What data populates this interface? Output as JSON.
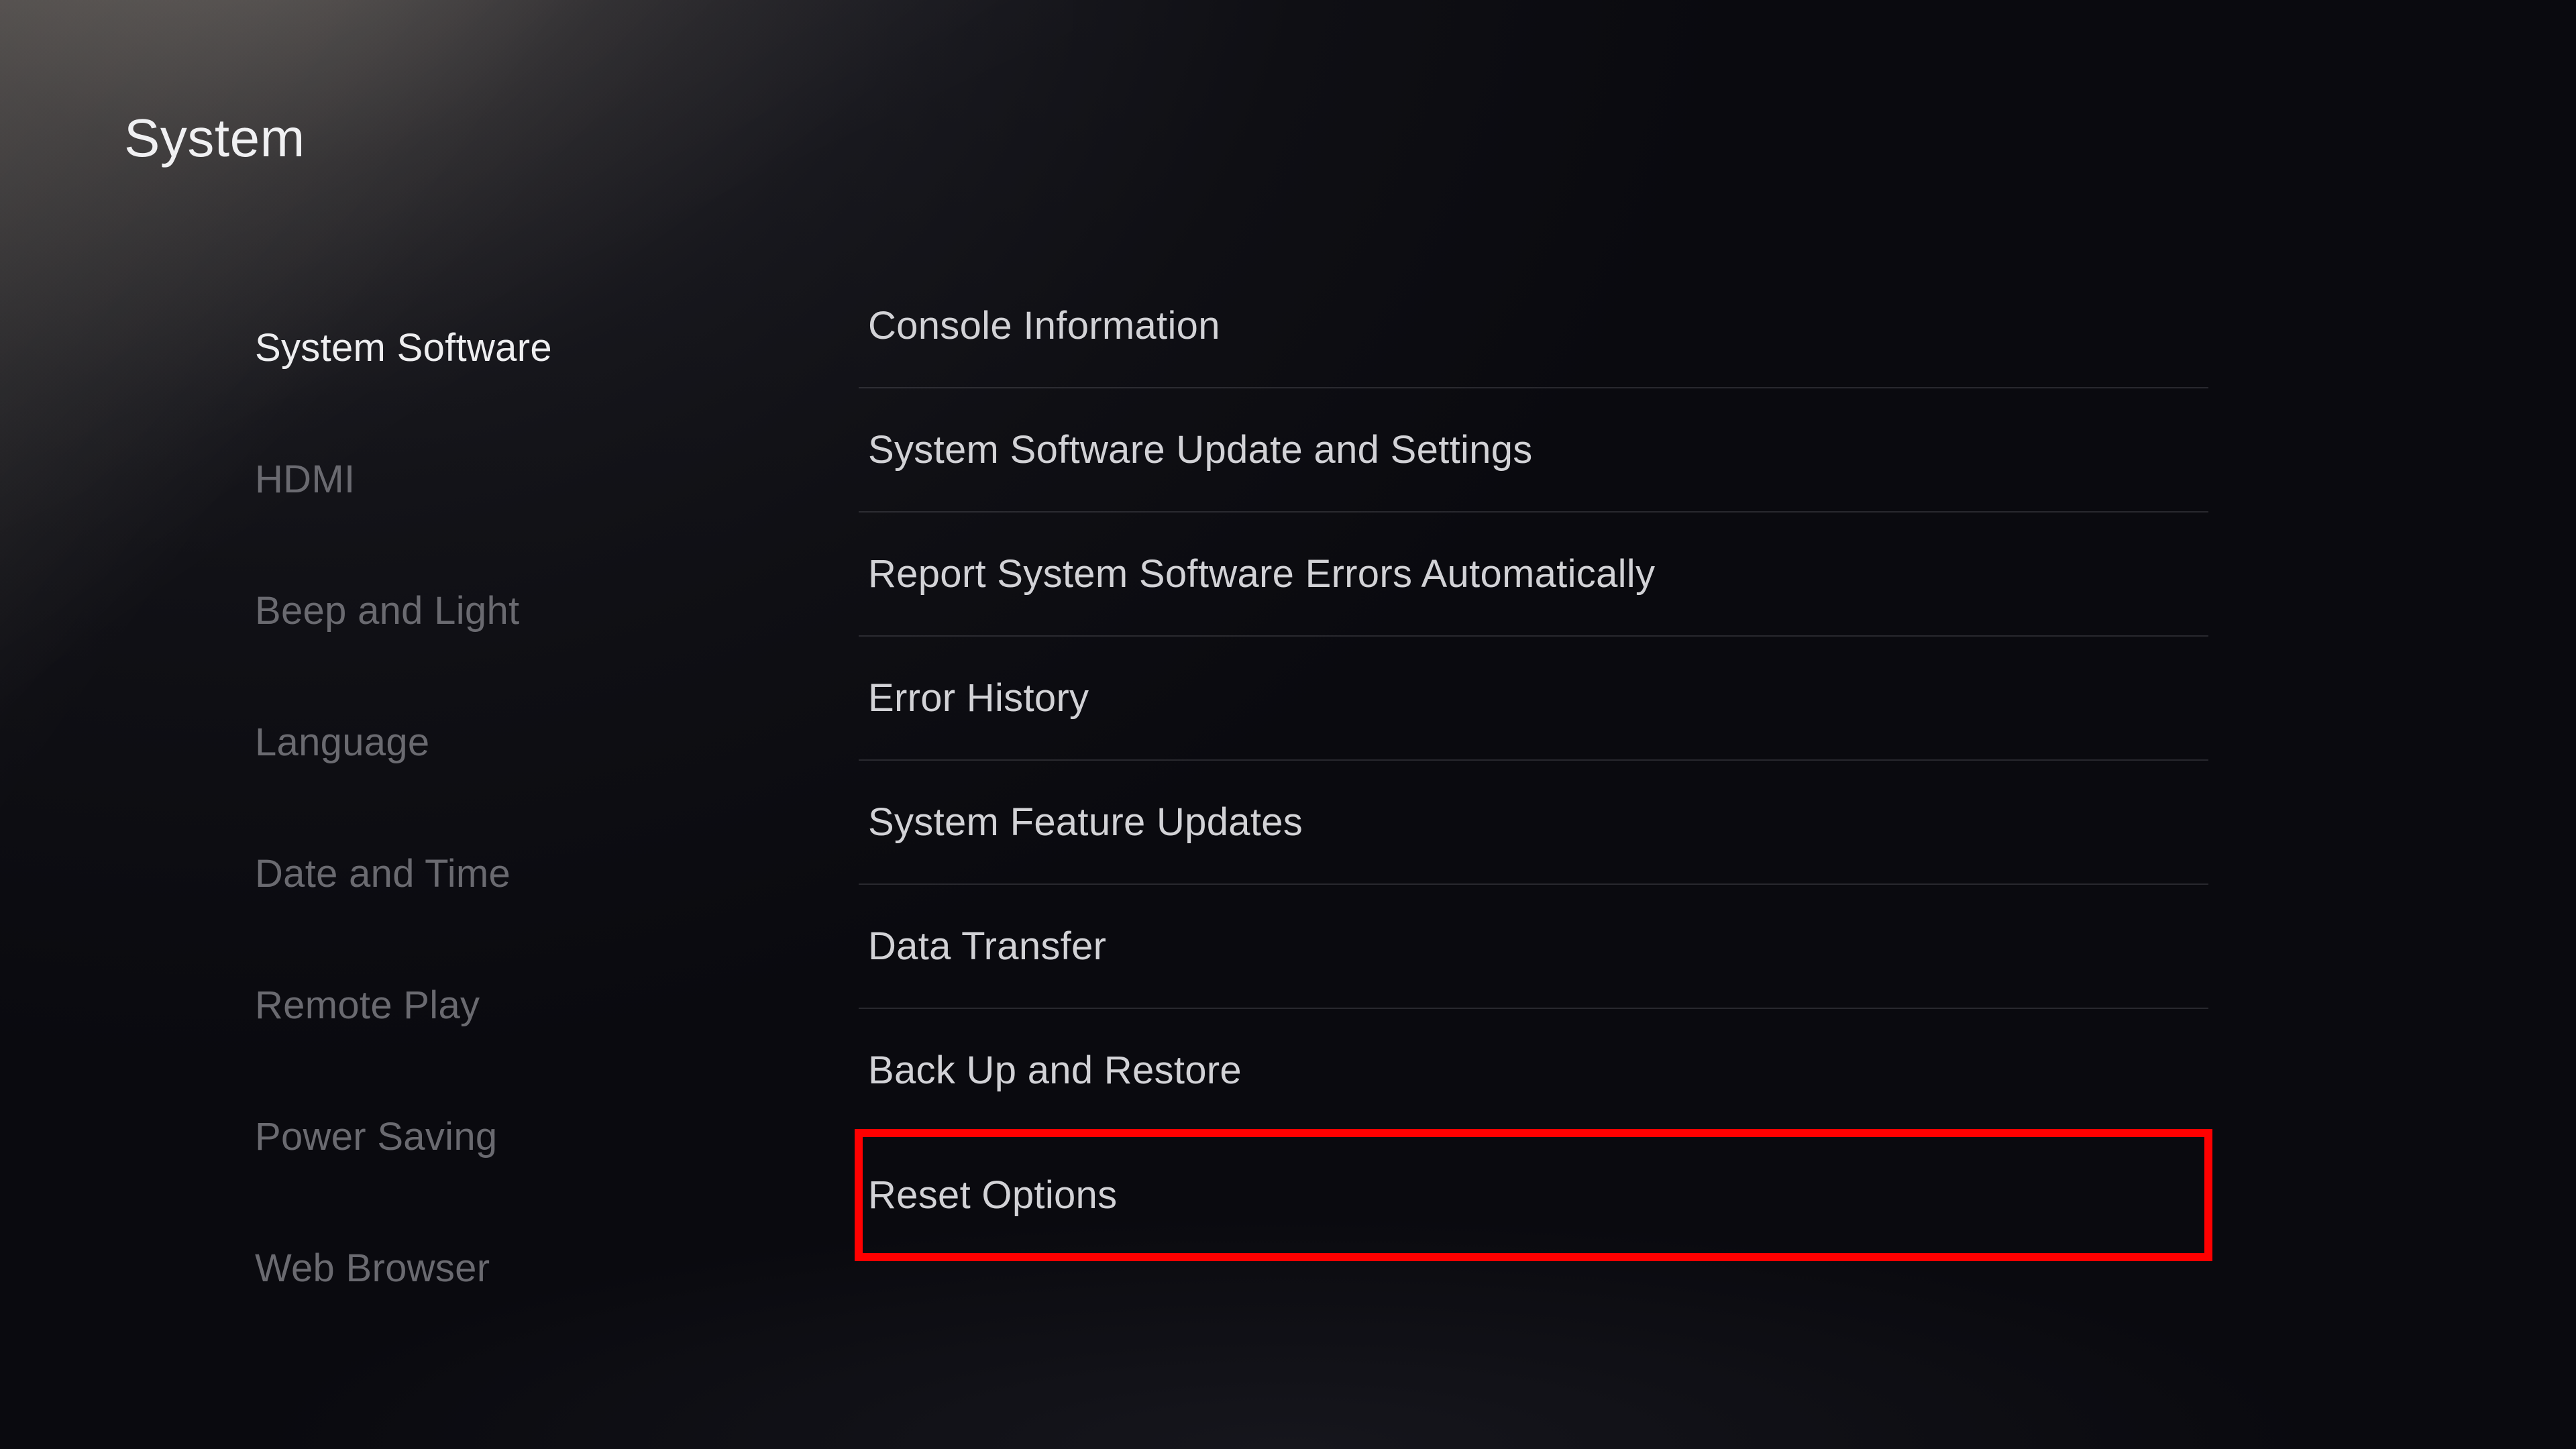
{
  "page": {
    "title": "System"
  },
  "sidebar": {
    "items": [
      {
        "label": "System Software",
        "selected": true
      },
      {
        "label": "HDMI",
        "selected": false
      },
      {
        "label": "Beep and Light",
        "selected": false
      },
      {
        "label": "Language",
        "selected": false
      },
      {
        "label": "Date and Time",
        "selected": false
      },
      {
        "label": "Remote Play",
        "selected": false
      },
      {
        "label": "Power Saving",
        "selected": false
      },
      {
        "label": "Web Browser",
        "selected": false
      }
    ]
  },
  "content": {
    "items": [
      {
        "label": "Console Information",
        "highlighted": false
      },
      {
        "label": "System Software Update and Settings",
        "highlighted": false
      },
      {
        "label": "Report System Software Errors Automatically",
        "highlighted": false
      },
      {
        "label": "Error History",
        "highlighted": false
      },
      {
        "label": "System Feature Updates",
        "highlighted": false
      },
      {
        "label": "Data Transfer",
        "highlighted": false
      },
      {
        "label": "Back Up and Restore",
        "highlighted": false
      },
      {
        "label": "Reset Options",
        "highlighted": true
      }
    ]
  }
}
